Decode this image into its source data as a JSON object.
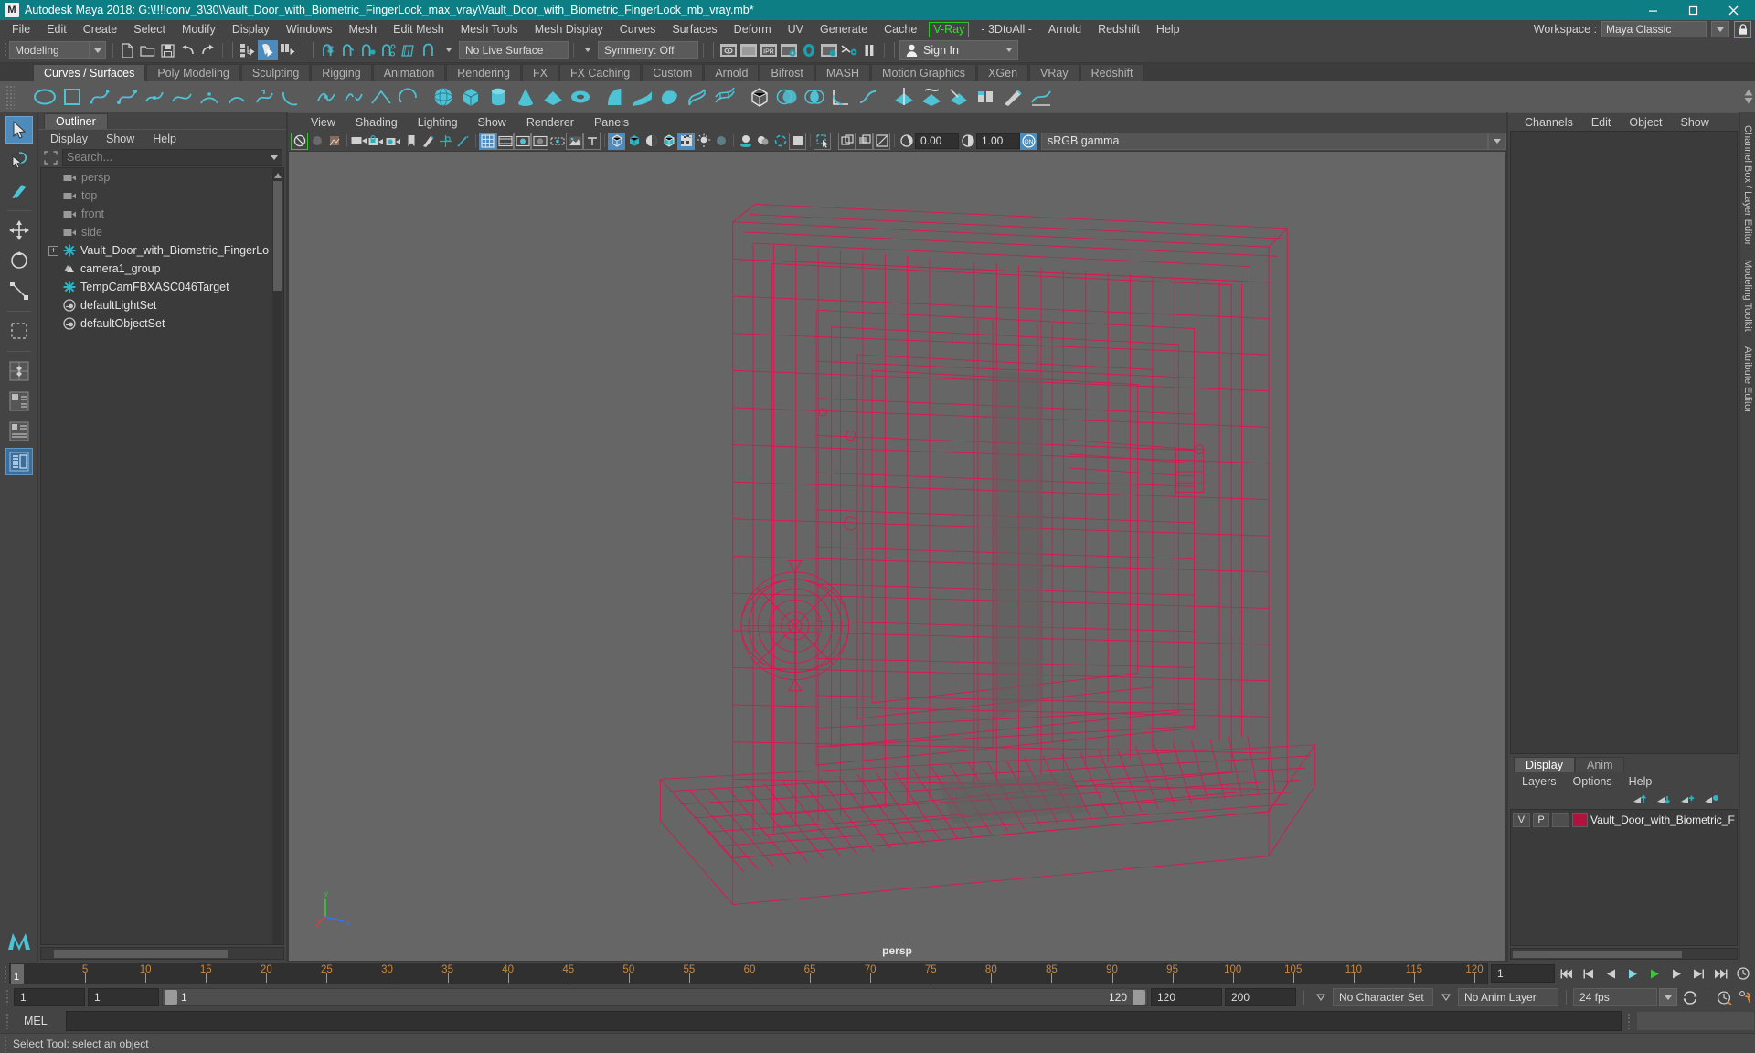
{
  "window": {
    "title": "Autodesk Maya 2018: G:\\!!!!conv_3\\30\\Vault_Door_with_Biometric_FingerLock_max_vray\\Vault_Door_with_Biometric_FingerLock_mb_vray.mb*",
    "app_initial": "M",
    "minimize_label": "Minimize",
    "maximize_label": "Restore",
    "close_label": "Close",
    "titlebar_color": "#0d7f84"
  },
  "menubar": {
    "items": [
      {
        "label": "File"
      },
      {
        "label": "Edit"
      },
      {
        "label": "Create"
      },
      {
        "label": "Select"
      },
      {
        "label": "Modify"
      },
      {
        "label": "Display"
      },
      {
        "label": "Windows"
      },
      {
        "label": "Mesh"
      },
      {
        "label": "Edit Mesh"
      },
      {
        "label": "Mesh Tools"
      },
      {
        "label": "Mesh Display"
      },
      {
        "label": "Curves"
      },
      {
        "label": "Surfaces"
      },
      {
        "label": "Deform"
      },
      {
        "label": "UV"
      },
      {
        "label": "Generate"
      },
      {
        "label": "Cache"
      },
      {
        "label": "V-Ray",
        "highlighted": true
      },
      {
        "label": "- 3DtoAll -"
      },
      {
        "label": "Arnold"
      },
      {
        "label": "Redshift"
      },
      {
        "label": "Help"
      }
    ],
    "workspace_label": "Workspace :",
    "workspace_value": "Maya Classic",
    "highlight_color": "#2ecc2e"
  },
  "statusline": {
    "mode": "Modeling",
    "live_surface": "No Live Surface",
    "symmetry": "Symmetry: Off",
    "signin": "Sign In"
  },
  "shelf": {
    "tabs": [
      {
        "label": "Curves / Surfaces",
        "active": true
      },
      {
        "label": "Poly Modeling",
        "active": false
      },
      {
        "label": "Sculpting",
        "active": false
      },
      {
        "label": "Rigging",
        "active": false
      },
      {
        "label": "Animation",
        "active": false
      },
      {
        "label": "Rendering",
        "active": false
      },
      {
        "label": "FX",
        "active": false
      },
      {
        "label": "FX Caching",
        "active": false
      },
      {
        "label": "Custom",
        "active": false
      },
      {
        "label": "Arnold",
        "active": false
      },
      {
        "label": "Bifrost",
        "active": false
      },
      {
        "label": "MASH",
        "active": false
      },
      {
        "label": "Motion Graphics",
        "active": false
      },
      {
        "label": "XGen",
        "active": false
      },
      {
        "label": "VRay",
        "active": false
      },
      {
        "label": "Redshift",
        "active": false
      }
    ]
  },
  "outliner": {
    "tab": "Outliner",
    "menu": [
      "Display",
      "Show",
      "Help"
    ],
    "search_placeholder": "Search...",
    "items": [
      {
        "label": "persp",
        "icon": "camera-icon",
        "dim": true,
        "expander": false
      },
      {
        "label": "top",
        "icon": "camera-icon",
        "dim": true,
        "expander": false
      },
      {
        "label": "front",
        "icon": "camera-icon",
        "dim": true,
        "expander": false
      },
      {
        "label": "side",
        "icon": "camera-icon",
        "dim": true,
        "expander": false
      },
      {
        "label": "Vault_Door_with_Biometric_FingerLo",
        "icon": "transform-icon",
        "dim": false,
        "expander": true
      },
      {
        "label": "camera1_group",
        "icon": "group-icon",
        "dim": false,
        "expander": false
      },
      {
        "label": "TempCamFBXASC046Target",
        "icon": "transform-icon",
        "dim": false,
        "expander": false
      },
      {
        "label": "defaultLightSet",
        "icon": "set-icon",
        "dim": false,
        "expander": false
      },
      {
        "label": "defaultObjectSet",
        "icon": "set-icon",
        "dim": false,
        "expander": false
      }
    ]
  },
  "viewport": {
    "menu": [
      "View",
      "Shading",
      "Lighting",
      "Show",
      "Renderer",
      "Panels"
    ],
    "exposure_value": "0.00",
    "gamma_value": "1.00",
    "color_management": "sRGB gamma",
    "camera_label": "persp",
    "background_color": "#666666",
    "wireframe_color": "#e5104e",
    "axis": {
      "x": "x",
      "y": "y",
      "z": "z"
    }
  },
  "channelbox": {
    "menu": [
      "Channels",
      "Edit",
      "Object",
      "Show"
    ],
    "vertical_tabs": [
      "Channel Box / Layer Editor",
      "Modeling Toolkit",
      "Attribute Editor"
    ]
  },
  "layers": {
    "tabs": [
      {
        "label": "Display",
        "active": true
      },
      {
        "label": "Anim",
        "active": false
      }
    ],
    "menu": [
      "Layers",
      "Options",
      "Help"
    ],
    "rows": [
      {
        "visibility": "V",
        "playback": "P",
        "state": "",
        "color": "#b3123f",
        "name": "Vault_Door_with_Biometric_Fi"
      }
    ]
  },
  "timeslider": {
    "ticks": [
      5,
      10,
      15,
      20,
      25,
      30,
      35,
      40,
      45,
      50,
      55,
      60,
      65,
      70,
      75,
      80,
      85,
      90,
      95,
      100,
      105,
      110,
      115,
      120
    ],
    "current_frame": "1",
    "current_frame_field": "1"
  },
  "rangeslider": {
    "start_field": "1",
    "range_start_field": "1",
    "range_bar_start": "1",
    "range_bar_end": "120",
    "end_field": "120",
    "playback_end_field": "200",
    "character_set": "No Character Set",
    "anim_layer": "No Anim Layer",
    "fps": "24 fps"
  },
  "command": {
    "label": "MEL",
    "input_value": ""
  },
  "status": {
    "message": "Select Tool: select an object"
  }
}
